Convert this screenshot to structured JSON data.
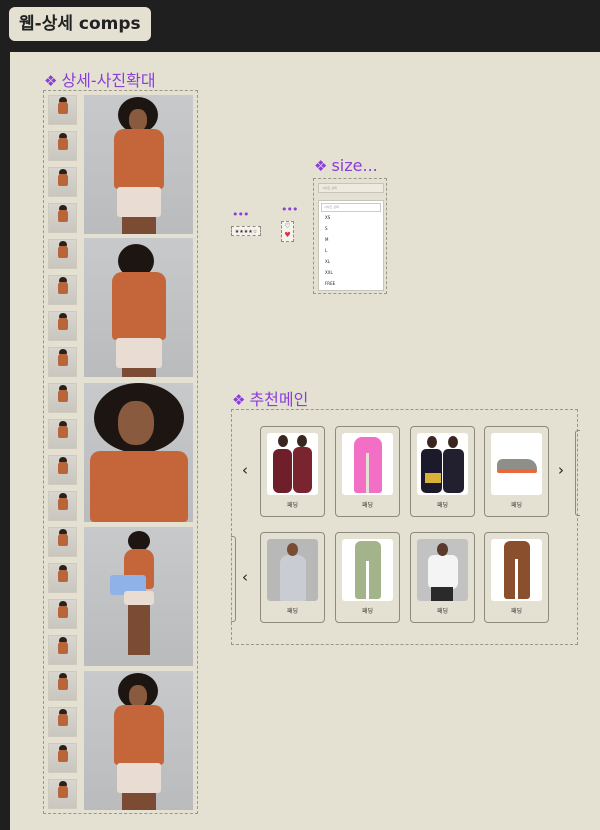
{
  "page_tag": "웹-상세 comps",
  "frames": {
    "photo_zoom": "상세-사진확대",
    "size": "size...",
    "recommend": "추천메인"
  },
  "diamond_glyph": "❖",
  "size_selector": {
    "placeholder": "사이즈 선택",
    "list_header": "사이즈 선택",
    "options": [
      "XS",
      "S",
      "M",
      "L",
      "XL",
      "XXL",
      "FREE"
    ]
  },
  "rating_stars": "★★★★☆",
  "heart_icons": [
    "♡",
    "♥"
  ],
  "recommend": {
    "row1": [
      "패딩",
      "패딩",
      "패딩",
      "패딩"
    ],
    "row2": [
      "패딩",
      "패딩",
      "패딩",
      "패딩"
    ],
    "prev": "‹",
    "next": "›"
  },
  "colors": {
    "accent_purple": "#8a3fd8",
    "canvas_bg": "#e4e1d3",
    "top_bar": "#1f1f1f",
    "garment_rust": "#c4663a"
  }
}
